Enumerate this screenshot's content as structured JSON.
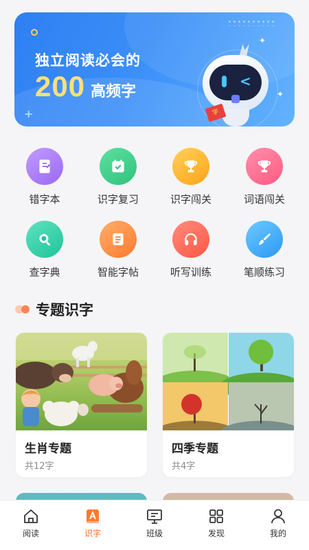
{
  "banner": {
    "line1": "独立阅读必会的",
    "number": "200",
    "subtitle": "高频字",
    "book_text": "学"
  },
  "features": [
    {
      "label": "错字本",
      "icon": "notebook-icon",
      "color": "#a875f5"
    },
    {
      "label": "识字复习",
      "icon": "calendar-check-icon",
      "color": "#3ccf86"
    },
    {
      "label": "识字闯关",
      "icon": "trophy-icon",
      "color": "#ffb21a"
    },
    {
      "label": "词语闯关",
      "icon": "trophy-icon",
      "color": "#ff6b8f"
    },
    {
      "label": "查字典",
      "icon": "search-icon",
      "color": "#2fd0a6"
    },
    {
      "label": "智能字帖",
      "icon": "document-icon",
      "color": "#ff8a3d"
    },
    {
      "label": "听写训练",
      "icon": "headphones-icon",
      "color": "#ff6a55"
    },
    {
      "label": "笔顺练习",
      "icon": "brush-icon",
      "color": "#3aa7ff"
    }
  ],
  "section": {
    "title": "专题识字"
  },
  "cards": [
    {
      "title": "生肖专题",
      "subtitle": "共12字"
    },
    {
      "title": "四季专题",
      "subtitle": "共4字"
    }
  ],
  "tabbar": {
    "active": "识字",
    "tabs": [
      {
        "label": "阅读",
        "icon": "house-icon"
      },
      {
        "label": "识字",
        "icon": "literacy-icon"
      },
      {
        "label": "班级",
        "icon": "board-icon"
      },
      {
        "label": "发现",
        "icon": "grid-icon"
      },
      {
        "label": "我的",
        "icon": "user-icon"
      }
    ]
  }
}
